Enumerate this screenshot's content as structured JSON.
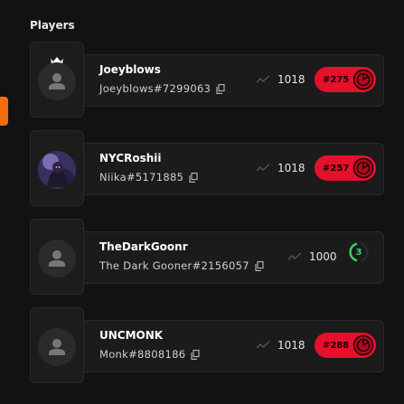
{
  "section": {
    "title": "Players"
  },
  "players": [
    {
      "name": "Joeyblows",
      "tag": "Joeyblows#7299063",
      "rating": "1018",
      "rank": "#275",
      "leader": true,
      "avatar": "default-avatar"
    },
    {
      "name": "NYCRoshii",
      "tag": "Niika#5171885",
      "rating": "1018",
      "rank": "#257",
      "leader": false,
      "avatar": "profile-photo"
    },
    {
      "name": "TheDarkGoonr",
      "tag": "The Dark Gooner#2156057",
      "rating": "1000",
      "placement": "3",
      "leader": false,
      "avatar": "default-avatar"
    },
    {
      "name": "UNCMONK",
      "tag": "Monk#8808186",
      "rating": "1018",
      "rank": "#288",
      "leader": false,
      "avatar": "default-avatar"
    }
  ],
  "colors": {
    "accent": "#f26b0c",
    "rank_badge": "#e5102c",
    "placement": "#3ed06b"
  },
  "icons": [
    "crown-icon",
    "copy-icon",
    "trend-icon",
    "rank-emblem-icon",
    "placement-ring-icon",
    "default-avatar-icon"
  ]
}
